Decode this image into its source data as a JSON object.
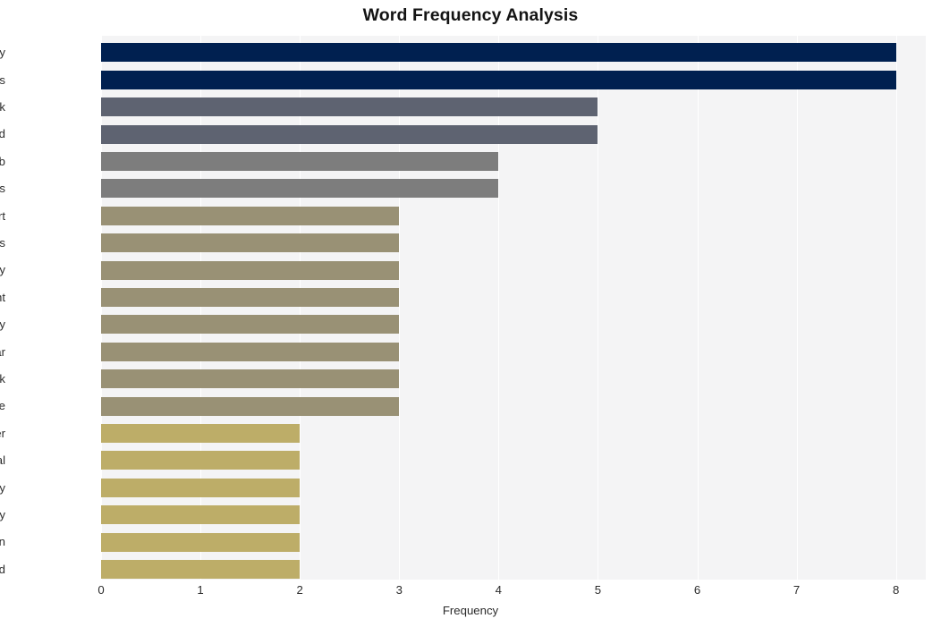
{
  "chart_data": {
    "type": "bar",
    "orientation": "horizontal",
    "title": "Word Frequency Analysis",
    "xlabel": "Frequency",
    "ylabel": "",
    "categories": [
      "cybersecurity",
      "workers",
      "work",
      "weekend",
      "job",
      "threats",
      "report",
      "professionals",
      "company",
      "highlight",
      "nearly",
      "year",
      "look",
      "increase",
      "bitdefender",
      "reveal",
      "frequently",
      "security",
      "concern",
      "lead"
    ],
    "values": [
      8,
      8,
      5,
      5,
      4,
      4,
      3,
      3,
      3,
      3,
      3,
      3,
      3,
      3,
      2,
      2,
      2,
      2,
      2,
      2
    ],
    "xticks": [
      0,
      1,
      2,
      3,
      4,
      5,
      6,
      7,
      8
    ],
    "xlim": [
      0,
      8.3
    ],
    "grid": true,
    "legend": false,
    "bar_colors": [
      "#002050",
      "#002050",
      "#5e6371",
      "#5e6371",
      "#7d7d7d",
      "#7d7d7d",
      "#999175",
      "#999175",
      "#999175",
      "#999175",
      "#999175",
      "#999175",
      "#999175",
      "#999175",
      "#bdad68",
      "#bdad68",
      "#bdad68",
      "#bdad68",
      "#bdad68",
      "#bdad68"
    ],
    "plot_background": "#f4f4f5",
    "gridline_color": "#ffffff",
    "figure_background": "#ffffff",
    "title_color": "#141414",
    "tick_label_color": "#2b2b2b"
  }
}
